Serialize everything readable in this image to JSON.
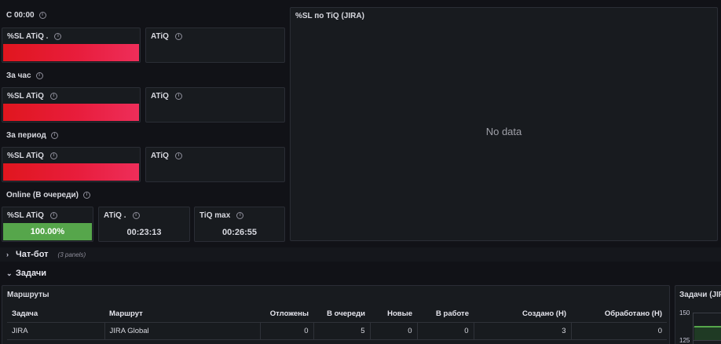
{
  "rows": {
    "c00": "С 00:00",
    "hour": "За час",
    "period": "За период",
    "online": "Online (В очереди)"
  },
  "panels": {
    "sl_c00": {
      "title": "%SL ATiQ ."
    },
    "atiq_c00": {
      "title": "ATiQ"
    },
    "sl_hour": {
      "title": "%SL ATiQ"
    },
    "atiq_hour": {
      "title": "ATiQ"
    },
    "sl_period": {
      "title": "%SL ATiQ"
    },
    "atiq_period": {
      "title": "ATiQ"
    },
    "sl_online": {
      "title": "%SL ATiQ",
      "value": "100.00%"
    },
    "atiq_online": {
      "title": "ATiQ .",
      "value": "00:23:13"
    },
    "tiq_max": {
      "title": "TiQ max",
      "value": "00:26:55"
    },
    "big": {
      "title": "%SL по TiQ (JIRA)",
      "nodata": "No data"
    }
  },
  "sections": {
    "chatbot": {
      "label": "Чат-бот",
      "sub": "(3 panels)"
    },
    "tasks": {
      "label": "Задачи"
    }
  },
  "routes": {
    "title": "Маршруты",
    "headers": [
      "Задача",
      "Маршрут",
      "Отложены",
      "В очереди",
      "Новые",
      "В работе",
      "Создано (Н)",
      "Обработано (Н)"
    ],
    "rows": [
      [
        "JIRA",
        "JIRA Global",
        "0",
        "5",
        "0",
        "0",
        "3",
        "0"
      ]
    ]
  },
  "tasks_panel": {
    "title": "Задачи (JIR",
    "ticks": [
      "150",
      "125"
    ]
  },
  "colors": {
    "background": "#111217",
    "panel": "#181b1f",
    "red": "#e0161e",
    "pink": "#ee2e5a",
    "green": "#56a64b"
  }
}
